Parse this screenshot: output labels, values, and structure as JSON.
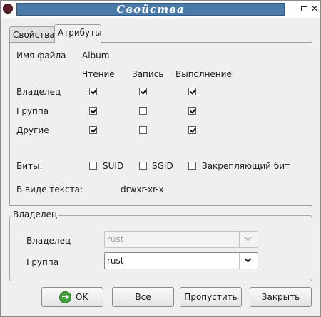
{
  "window": {
    "title": "Свойства"
  },
  "tabs": [
    {
      "label": "Свойства"
    },
    {
      "label": "Атрибуты"
    }
  ],
  "attributes": {
    "filename_label": "Имя файла",
    "filename_value": "Album",
    "columns": {
      "read": "Чтение",
      "write": "Запись",
      "execute": "Выполнение"
    },
    "rows": [
      {
        "label": "Владелец",
        "read": true,
        "write": true,
        "execute": true
      },
      {
        "label": "Группа",
        "read": true,
        "write": false,
        "execute": true
      },
      {
        "label": "Другие",
        "read": true,
        "write": false,
        "execute": true
      }
    ],
    "bits_label": "Биты:",
    "bits": [
      {
        "label": "SUID",
        "checked": false
      },
      {
        "label": "SGID",
        "checked": false
      },
      {
        "label": "Закрепляющий бит",
        "checked": false
      }
    ],
    "text_form_label": "В виде текста:",
    "text_form_value": "drwxr-xr-x"
  },
  "owner_group": {
    "legend": "Владелец",
    "owner_label": "Владелец",
    "owner_value": "rust",
    "group_label": "Группа",
    "group_value": "rust"
  },
  "buttons": {
    "ok": "OK",
    "all": "Все",
    "skip": "Пропустить",
    "close": "Закрыть"
  },
  "icons": {
    "app": "app-icon",
    "ok": "ok-icon"
  }
}
